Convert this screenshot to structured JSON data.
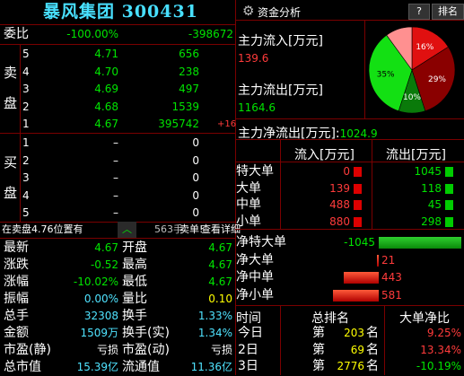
{
  "header": {
    "title": "暴风集团 300431",
    "tab": "资金分析",
    "help": "?",
    "rank": "排名"
  },
  "wei": {
    "label": "委比",
    "ratio": "-100.00%",
    "diff": "-398672"
  },
  "sell": {
    "side_label_1": "卖",
    "side_label_2": "盘",
    "rows": [
      {
        "level": "5",
        "price": "4.71",
        "vol": "656",
        "chg": ""
      },
      {
        "level": "4",
        "price": "4.70",
        "vol": "238",
        "chg": ""
      },
      {
        "level": "3",
        "price": "4.69",
        "vol": "497",
        "chg": ""
      },
      {
        "level": "2",
        "price": "4.68",
        "vol": "1539",
        "chg": ""
      },
      {
        "level": "1",
        "price": "4.67",
        "vol": "395742",
        "chg": "+16"
      }
    ]
  },
  "buy": {
    "side_label_1": "买",
    "side_label_2": "盘",
    "rows": [
      {
        "level": "1",
        "price": "–",
        "vol": "0"
      },
      {
        "level": "2",
        "price": "–",
        "vol": "0"
      },
      {
        "level": "3",
        "price": "–",
        "vol": "0"
      },
      {
        "level": "4",
        "price": "–",
        "vol": "0"
      },
      {
        "level": "5",
        "price": "–",
        "vol": "0"
      }
    ]
  },
  "status": {
    "position": "在卖盘4.76位置有",
    "count": "563手",
    "action": "卖单!",
    "detail": "查看详细"
  },
  "quote": {
    "rows": [
      {
        "l": "最新",
        "lv": "4.67",
        "r": "开盘",
        "rv": "4.67"
      },
      {
        "l": "涨跌",
        "lv": "-0.52",
        "r": "最高",
        "rv": "4.67"
      },
      {
        "l": "涨幅",
        "lv": "-10.02%",
        "r": "最低",
        "rv": "4.67"
      },
      {
        "l": "振幅",
        "lv": "0.00%",
        "r": "量比",
        "rv": "0.10"
      },
      {
        "l": "总手",
        "lv": "32308",
        "r": "换手",
        "rv": "1.33%"
      },
      {
        "l": "金额",
        "lv": "1509万",
        "r": "换手(实)",
        "rv": "1.34%"
      },
      {
        "l": "市盈(静)",
        "lv": "亏损",
        "r": "市盈(动)",
        "rv": "亏损"
      },
      {
        "l": "总市值",
        "lv": "15.39亿",
        "r": "流通值",
        "rv": "11.36亿"
      }
    ]
  },
  "flow": {
    "in_label": "主力流入[万元]",
    "in_value": "139.6",
    "out_label": "主力流出[万元]",
    "out_value": "1164.6",
    "net_label": "主力净流出[万元]:",
    "net_value": "1024.9"
  },
  "pie": {
    "slices": [
      {
        "label": "16%",
        "value": 16,
        "color": "#e01010"
      },
      {
        "label": "29%",
        "value": 29,
        "color": "#8a0000"
      },
      {
        "label": "10%",
        "value": 10,
        "color": "#0a7a0a"
      },
      {
        "label": "35%",
        "value": 35,
        "color": "#13e013"
      },
      {
        "label": "",
        "value": 10,
        "color": "#ff9090"
      }
    ]
  },
  "orders": {
    "head_in": "流入[万元]",
    "head_out": "流出[万元]",
    "rows": [
      {
        "label": "特大单",
        "in": "0",
        "out": "1045"
      },
      {
        "label": "大单",
        "in": "139",
        "out": "118"
      },
      {
        "label": "中单",
        "in": "488",
        "out": "45"
      },
      {
        "label": "小单",
        "in": "880",
        "out": "298"
      }
    ]
  },
  "net": {
    "rows": [
      {
        "label": "净特大单",
        "value": "-1045",
        "amount": -1045
      },
      {
        "label": "净大单",
        "value": "21",
        "amount": 21
      },
      {
        "label": "净中单",
        "value": "443",
        "amount": 443
      },
      {
        "label": "净小单",
        "value": "581",
        "amount": 581
      }
    ]
  },
  "rank": {
    "head_time": "时间",
    "head_total": "总排名",
    "head_net": "大单净比",
    "rows": [
      {
        "time": "今日",
        "pre": "第",
        "rank": "203",
        "post": "名",
        "pct": "9.25%"
      },
      {
        "time": "2日",
        "pre": "第",
        "rank": "69",
        "post": "名",
        "pct": "13.34%"
      },
      {
        "time": "3日",
        "pre": "第",
        "rank": "2776",
        "post": "名",
        "pct": "-10.19%"
      }
    ]
  }
}
